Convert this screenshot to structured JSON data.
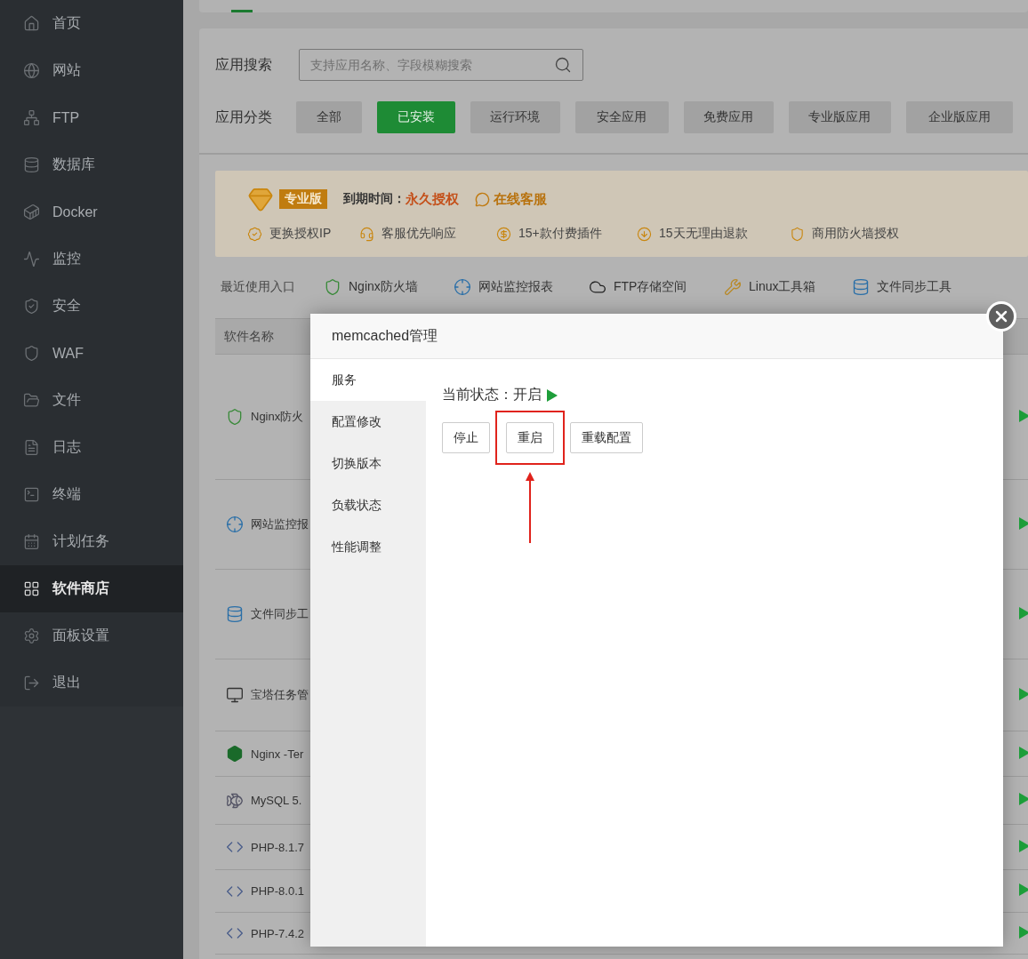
{
  "sidebar": {
    "items": [
      {
        "label": "首页",
        "selected": false
      },
      {
        "label": "网站",
        "selected": false
      },
      {
        "label": "FTP",
        "selected": false
      },
      {
        "label": "数据库",
        "selected": false
      },
      {
        "label": "Docker",
        "selected": false
      },
      {
        "label": "监控",
        "selected": false
      },
      {
        "label": "安全",
        "selected": false
      },
      {
        "label": "WAF",
        "selected": false
      },
      {
        "label": "文件",
        "selected": false
      },
      {
        "label": "日志",
        "selected": false
      },
      {
        "label": "终端",
        "selected": false
      },
      {
        "label": "计划任务",
        "selected": false
      },
      {
        "label": "软件商店",
        "selected": true
      },
      {
        "label": "面板设置",
        "selected": false
      },
      {
        "label": "退出",
        "selected": false
      }
    ]
  },
  "search": {
    "label": "应用搜索",
    "placeholder": "支持应用名称、字段模糊搜索"
  },
  "categories": {
    "label": "应用分类",
    "items": [
      {
        "label": "全部",
        "selected": false
      },
      {
        "label": "已安装",
        "selected": true
      },
      {
        "label": "运行环境",
        "selected": false
      },
      {
        "label": "安全应用",
        "selected": false
      },
      {
        "label": "免费应用",
        "selected": false
      },
      {
        "label": "专业版应用",
        "selected": false
      },
      {
        "label": "企业版应用",
        "selected": false
      }
    ]
  },
  "pro_banner": {
    "badge": "专业版",
    "expiry_label": "到期时间：",
    "expiry_value": "永久授权",
    "support_link": "在线客服",
    "perks": [
      "更换授权IP",
      "客服优先响应",
      "15+款付费插件",
      "15天无理由退款",
      "商用防火墙授权"
    ]
  },
  "recent": {
    "label": "最近使用入口",
    "items": [
      "Nginx防火墙",
      "网站监控报表",
      "FTP存储空间",
      "Linux工具箱",
      "文件同步工具"
    ]
  },
  "table": {
    "columns": [
      "软件名称"
    ],
    "rows": [
      {
        "name": "Nginx防火",
        "running": true
      },
      {
        "name": "网站监控报",
        "running": true
      },
      {
        "name": "文件同步工",
        "running": true
      },
      {
        "name": "宝塔任务管",
        "running": true
      },
      {
        "name": "Nginx -Ter",
        "running": true
      },
      {
        "name": "MySQL 5.",
        "running": true
      },
      {
        "name": "PHP-8.1.7",
        "running": true
      },
      {
        "name": "PHP-8.0.1",
        "running": true
      },
      {
        "name": "PHP-7.4.2",
        "running": true
      }
    ]
  },
  "modal": {
    "title": "memcached管理",
    "tabs": [
      {
        "label": "服务",
        "selected": true
      },
      {
        "label": "配置修改",
        "selected": false
      },
      {
        "label": "切换版本",
        "selected": false
      },
      {
        "label": "负载状态",
        "selected": false
      },
      {
        "label": "性能调整",
        "selected": false
      }
    ],
    "status_label": "当前状态：",
    "status_value": "开启",
    "running": true,
    "buttons": [
      {
        "label": "停止",
        "highlighted": false
      },
      {
        "label": "重启",
        "highlighted": true
      },
      {
        "label": "重载配置",
        "highlighted": false
      }
    ]
  }
}
